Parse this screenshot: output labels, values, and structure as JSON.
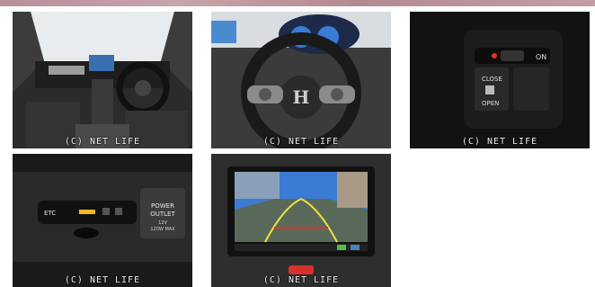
{
  "gallery": {
    "photos": [
      {
        "id": "interior",
        "watermark": "(C) NET LIFE"
      },
      {
        "id": "steering",
        "watermark": "(C) NET LIFE",
        "logo": "H"
      },
      {
        "id": "door",
        "watermark": "(C) NET LIFE",
        "labels": {
          "on": "ON",
          "close": "CLOSE",
          "open": "OPEN"
        }
      },
      {
        "id": "etc",
        "watermark": "(C) NET LIFE",
        "labels": {
          "etc": "ETC",
          "outlet_1": "POWER",
          "outlet_2": "OUTLET",
          "outlet_3": "12V",
          "outlet_4": "120W MAX"
        }
      },
      {
        "id": "nav",
        "watermark": "(C) NET LIFE"
      }
    ]
  },
  "colors": {
    "band": "#b88f98",
    "panel": "#1a1a1a",
    "screen": "#3a7bd5"
  }
}
